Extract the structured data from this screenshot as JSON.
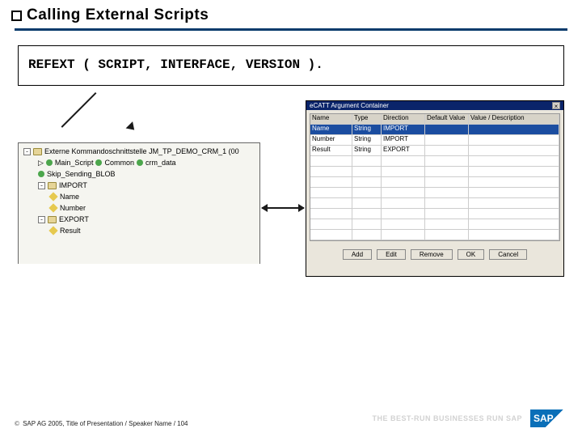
{
  "title": "Calling External Scripts",
  "code_line": "REFEXT ( SCRIPT, INTERFACE, VERSION ).",
  "tree": {
    "root_label": "Externe Kommandoschnittstelle JM_TP_DEMO_CRM_1 (00",
    "main_script_prefix": "Main_Script",
    "main_script_mid": "Common",
    "main_script_suffix": "crm_data",
    "skip_sending": "Skip_Sending_BLOB",
    "import_label": "IMPORT",
    "import_item1": "Name",
    "import_item2": "Number",
    "export_label": "EXPORT",
    "export_item1": "Result"
  },
  "dialog": {
    "title": "eCATT Argument Container",
    "headers": {
      "c1": "Name",
      "c2": "Type",
      "c3": "Direction",
      "c4": "Default Value",
      "c5": "Value / Description"
    },
    "rows": [
      {
        "c1": "Name",
        "c2": "String",
        "c3": "IMPORT",
        "c4": "",
        "c5": ""
      },
      {
        "c1": "Number",
        "c2": "String",
        "c3": "IMPORT",
        "c4": "",
        "c5": ""
      },
      {
        "c1": "Result",
        "c2": "String",
        "c3": "EXPORT",
        "c4": "",
        "c5": ""
      }
    ],
    "buttons": [
      "Add",
      "Edit",
      "Remove",
      "OK",
      "Cancel"
    ]
  },
  "footer": {
    "copyright_symbol": "©",
    "text": "SAP AG 2005, Title of Presentation / Speaker Name / 104",
    "tagline": "THE BEST-RUN BUSINESSES RUN SAP",
    "logo": "SAP"
  }
}
